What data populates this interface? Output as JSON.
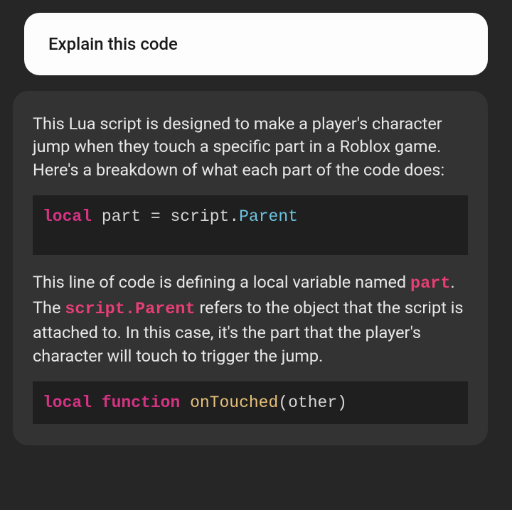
{
  "user_message": "Explain this code",
  "assistant": {
    "intro": "This Lua script is designed to make a player's character jump when they touch a specific part in a Roblox game. Here's a breakdown of what each part of the code does:",
    "code1": {
      "keyword_local": "local",
      "var": "part",
      "equals": "=",
      "obj": "script",
      "dot": ".",
      "prop": "Parent"
    },
    "explain1": {
      "pre": "This line of code is defining a local variable named ",
      "inline1": "part",
      "mid1": ". The ",
      "inline2": "script.Parent",
      "post": " refers to the object that the script is attached to. In this case, it's the part that the player's character will touch to trigger the jump."
    },
    "code2": {
      "keyword_local": "local",
      "keyword_function": "function",
      "func_name": "onTouched",
      "paren_open": "(",
      "param": "other",
      "paren_close": ")"
    }
  }
}
